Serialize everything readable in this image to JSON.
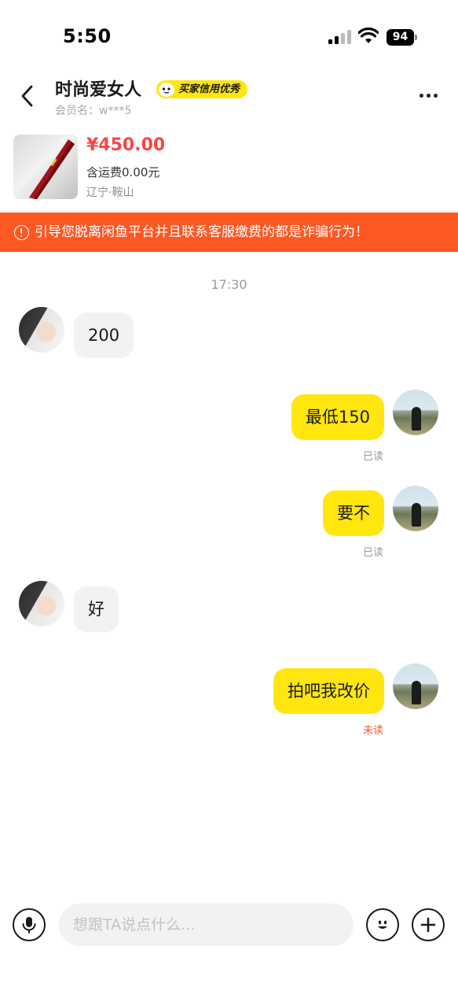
{
  "status_bar": {
    "time": "5:50",
    "battery": "94"
  },
  "header": {
    "title": "时尚爱女人",
    "badge": "买家信用优秀",
    "member": "会员名：w***5"
  },
  "product": {
    "price": "¥450.00",
    "shipping": "含运费0.00元",
    "location": "辽宁·鞍山"
  },
  "warning": {
    "text": "引导您脱离闲鱼平台并且联系客服缴费的都是诈骗行为！"
  },
  "chat": {
    "timestamp": "17:30",
    "messages": [
      {
        "side": "other",
        "text": "200"
      },
      {
        "side": "self",
        "text": "最低150",
        "status": "已读"
      },
      {
        "side": "self",
        "text": "要不",
        "status": "已读"
      },
      {
        "side": "other",
        "text": "好"
      },
      {
        "side": "self",
        "text": "拍吧我改价",
        "status": "未读"
      }
    ]
  },
  "input": {
    "placeholder": "想跟TA说点什么..."
  },
  "colors": {
    "accent_yellow": "#ffe60f",
    "warning_orange": "#ff5722",
    "price_red": "#ff4444",
    "unread_orange": "#ff5722"
  },
  "icons": [
    "back-arrow-icon",
    "fish-icon",
    "more-icon",
    "warning-icon",
    "mic-icon",
    "emoji-icon",
    "plus-icon",
    "signal-icon",
    "wifi-icon",
    "battery-icon"
  ]
}
